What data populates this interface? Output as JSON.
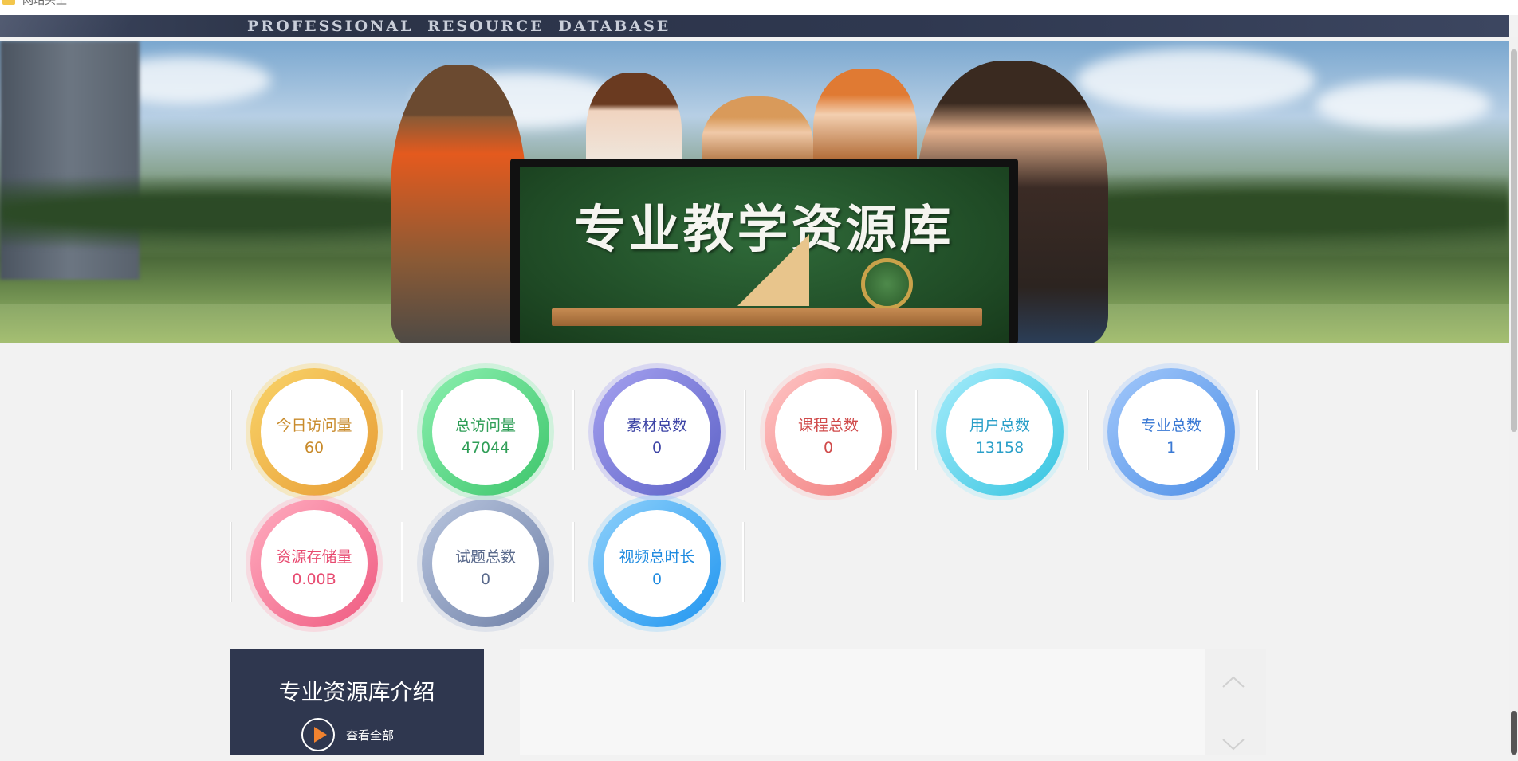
{
  "window": {
    "tab_title_cut": "网站头上"
  },
  "banner": {
    "motto": "PROFESSIONAL RESOURCE DATABASE",
    "hero_title": "专业教学资源库"
  },
  "stats": [
    {
      "label": "今日访问量",
      "value": "60",
      "color": "#e9a23b",
      "ring": [
        "#f9d46a",
        "#e79b33"
      ],
      "text": "#c88a2a"
    },
    {
      "label": "总访问量",
      "value": "47044",
      "color": "#37b866",
      "ring": [
        "#8cf0b0",
        "#3dc56b"
      ],
      "text": "#2f9e57"
    },
    {
      "label": "素材总数",
      "value": "0",
      "color": "#5b5fc9",
      "ring": [
        "#a6a2f0",
        "#5b60c6"
      ],
      "text": "#3d44a6"
    },
    {
      "label": "课程总数",
      "value": "0",
      "color": "#f06a6a",
      "ring": [
        "#ffc5c5",
        "#f07b7b"
      ],
      "text": "#d04a4a"
    },
    {
      "label": "用户总数",
      "value": "13158",
      "color": "#2bb8d8",
      "ring": [
        "#a6ecfb",
        "#35c4e0"
      ],
      "text": "#2a9fc8"
    },
    {
      "label": "专业总数",
      "value": "1",
      "color": "#4a8de6",
      "ring": [
        "#a4c9fb",
        "#4a8de6"
      ],
      "text": "#3a79d4"
    },
    {
      "label": "资源存储量",
      "value": "0.00B",
      "color": "#f2577b",
      "ring": [
        "#ffadc0",
        "#ef5a80"
      ],
      "text": "#e84a70"
    },
    {
      "label": "试题总数",
      "value": "0",
      "color": "#6c7fa8",
      "ring": [
        "#b9c6df",
        "#6e7fa6"
      ],
      "text": "#5a6a8c"
    },
    {
      "label": "视频总时长",
      "value": "0",
      "color": "#2196f3",
      "ring": [
        "#8fd1fb",
        "#1f95f0"
      ],
      "text": "#1f8be0"
    }
  ],
  "intro": {
    "heading": "专业资源库介绍",
    "more_label": "查看全部"
  }
}
